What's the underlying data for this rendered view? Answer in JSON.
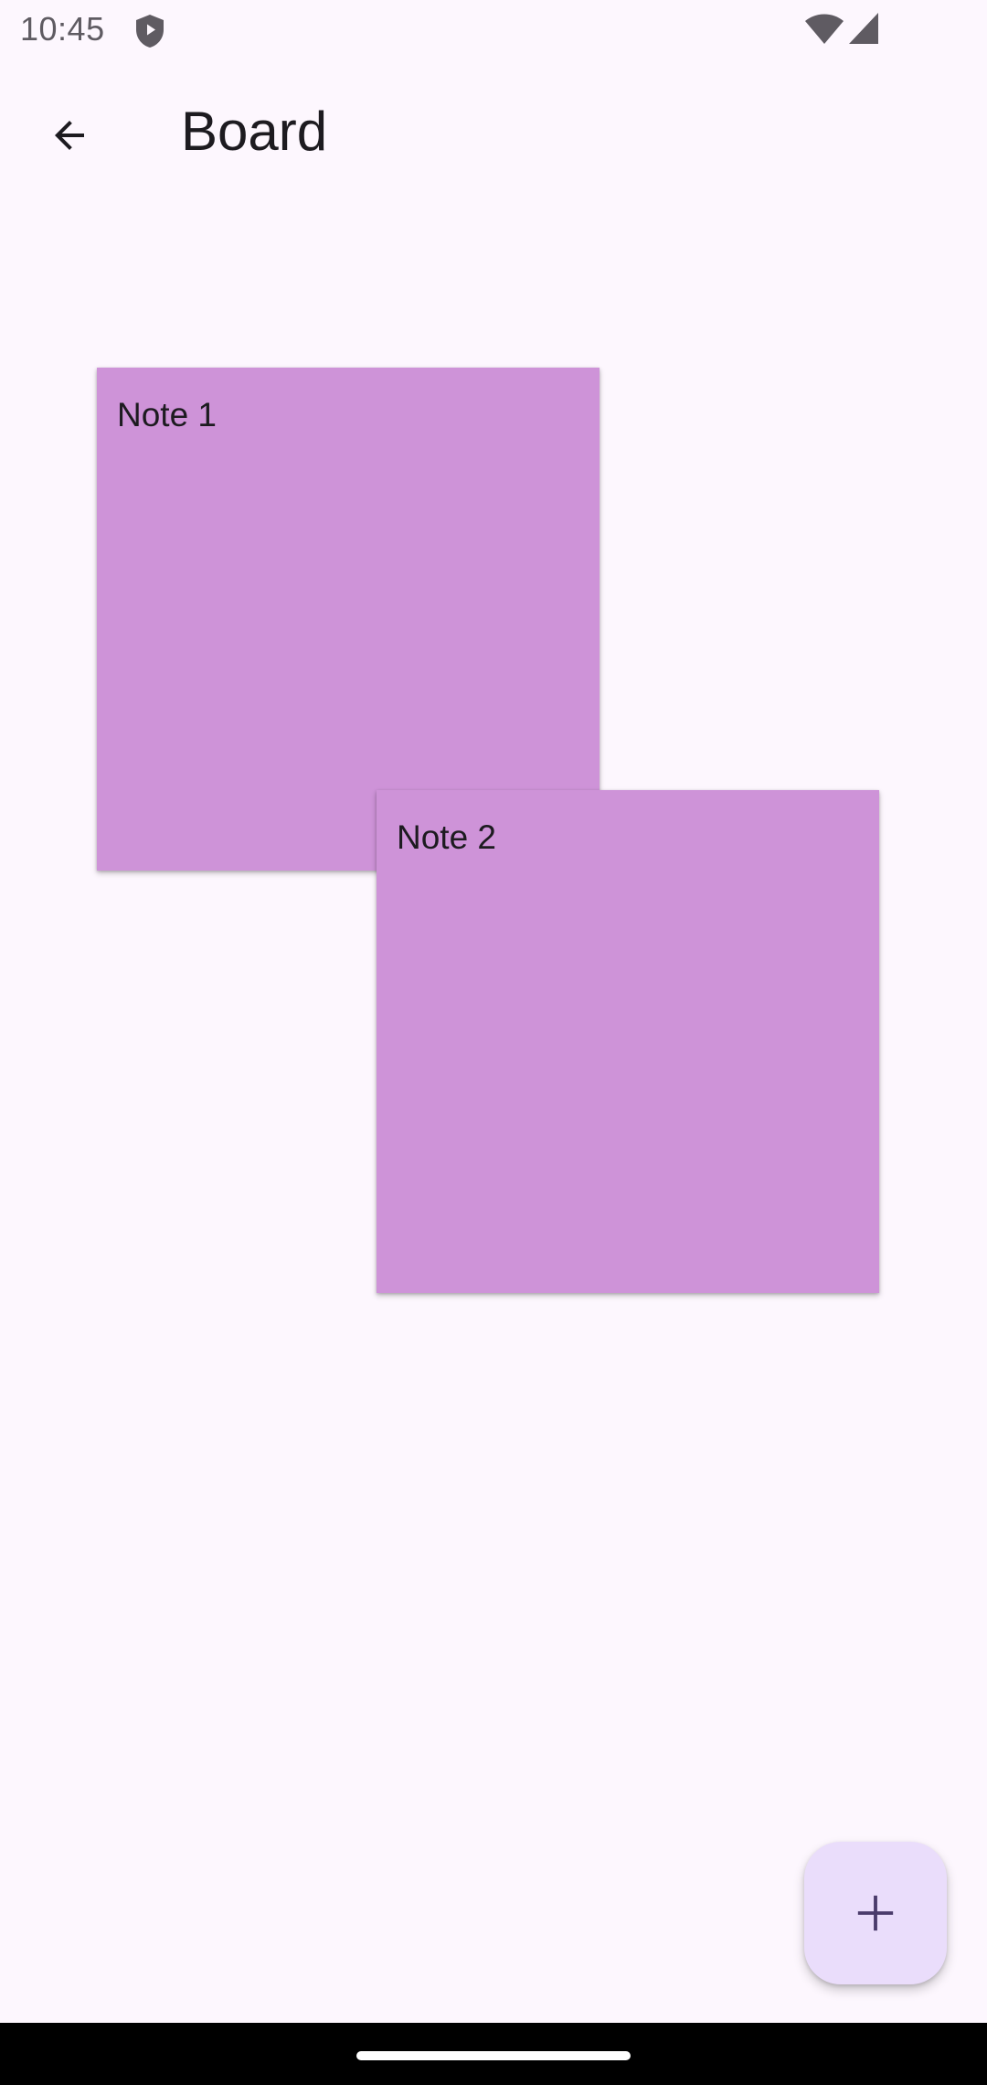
{
  "status_bar": {
    "time": "10:45",
    "icons": [
      "shield-icon",
      "wifi-icon",
      "cellular-signal-icon"
    ]
  },
  "app_bar": {
    "back_icon": "arrow-back-icon",
    "title": "Board"
  },
  "board": {
    "notes": [
      {
        "text": "Note 1",
        "color": "#ce93d8"
      },
      {
        "text": "Note 2",
        "color": "#ce93d8"
      }
    ]
  },
  "fab": {
    "icon": "plus-icon",
    "color": "#eaddfb",
    "icon_color": "#4a3b6b"
  },
  "colors": {
    "background": "#fdf7fe",
    "note": "#ce93d8",
    "text": "#1d1b20",
    "status_icons": "#5f5b62",
    "nav_bar": "#000000"
  }
}
